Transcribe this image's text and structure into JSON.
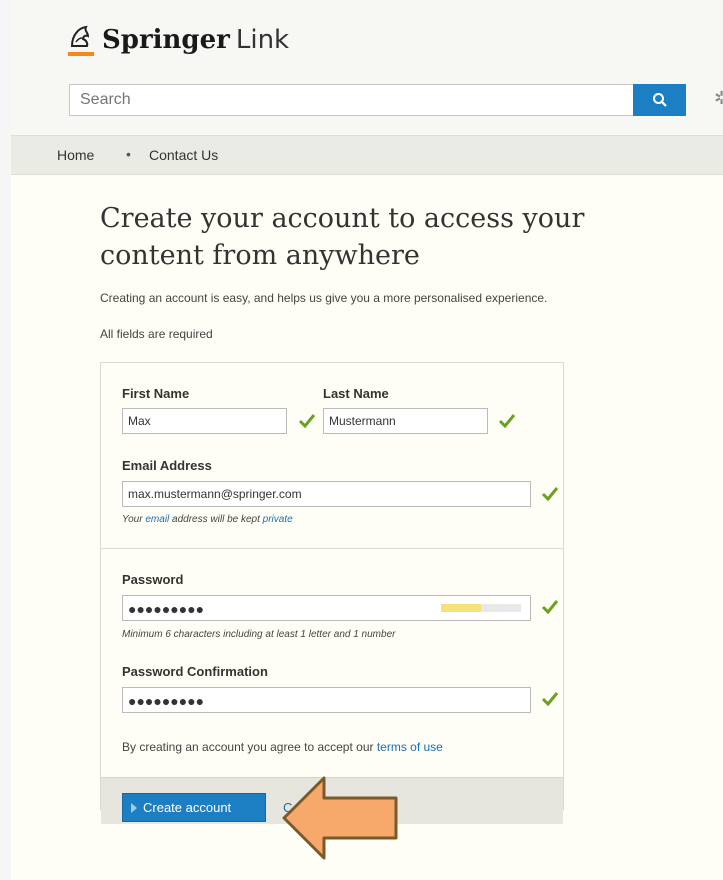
{
  "brand": {
    "name": "Springer",
    "suffix": "Link"
  },
  "search": {
    "placeholder": "Search"
  },
  "nav": {
    "items": [
      "Home",
      "Contact Us"
    ]
  },
  "page": {
    "title": "Create your account to access your content from anywhere",
    "intro": "Creating an account is easy, and helps us give you a more personalised experience.",
    "required_note": "All fields are required"
  },
  "form": {
    "first_name": {
      "label": "First Name",
      "value": "Max"
    },
    "last_name": {
      "label": "Last Name",
      "value": "Mustermann"
    },
    "email": {
      "label": "Email Address",
      "value": "max.mustermann@springer.com",
      "hint_prefix": "Your ",
      "hint_link1": "email",
      "hint_middle": " address will be kept ",
      "hint_link2": "private"
    },
    "password": {
      "label": "Password",
      "masked": "●●●●●●●●●",
      "hint": "Minimum 6 characters including at least 1 letter and 1 number",
      "strength": 0.5
    },
    "password_confirm": {
      "label": "Password Confirmation",
      "masked": "●●●●●●●●●"
    },
    "terms_prefix": "By creating an account you agree to accept our ",
    "terms_link": "terms of use",
    "submit_label": "Create account",
    "cancel_label": "C"
  },
  "colors": {
    "accent": "#1d7fc3",
    "check": "#6aa121",
    "arrow": "#f7a86b",
    "arrow_border": "#7a5a2a"
  }
}
